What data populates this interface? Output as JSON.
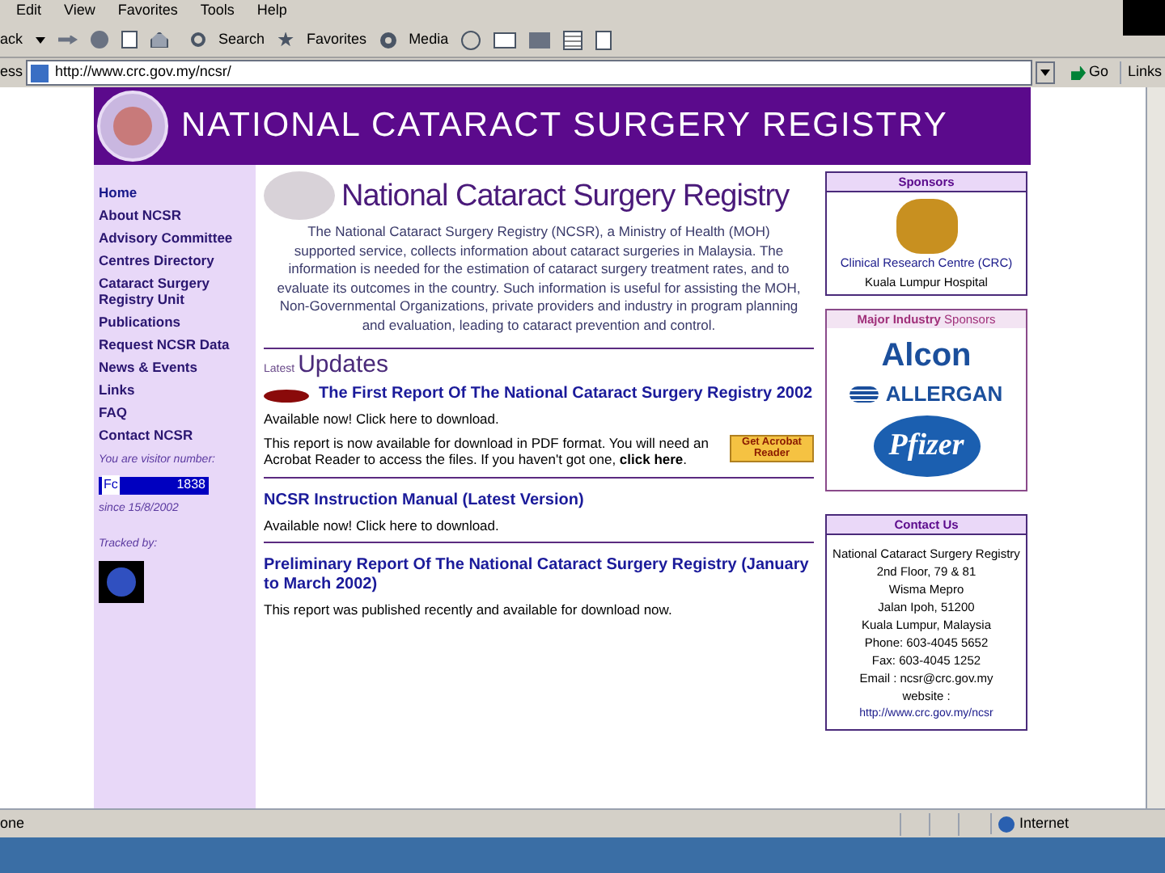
{
  "menu_bar": [
    "Edit",
    "View",
    "Favorites",
    "Tools",
    "Help"
  ],
  "toolbar": {
    "back": "ack",
    "search": "Search",
    "favorites": "Favorites",
    "media": "Media"
  },
  "address_bar": {
    "label": "ess",
    "value": "http://www.crc.gov.my/ncsr/",
    "go": "Go",
    "links": "Links"
  },
  "page": {
    "header_title": "NATIONAL CATARACT SURGERY REGISTRY",
    "nav": [
      {
        "label": "Home"
      },
      {
        "label": "**About** NCSR"
      },
      {
        "label": "Advisory Committee"
      },
      {
        "label": "Centres Directory"
      },
      {
        "label": "Cataract Surgery Registry Unit"
      },
      {
        "label": "Publications"
      },
      {
        "label": "Request NCSR Data"
      },
      {
        "label": "News & Events"
      },
      {
        "label": "Links"
      },
      {
        "label": "FAQ"
      },
      {
        "label": "**Contact** NCSR"
      }
    ],
    "visitor": {
      "label": "You are visitor number:",
      "counter_prefix": "Fc",
      "counter": "1838",
      "since": "since 15/8/2002",
      "tracked_by": "Tracked by:"
    },
    "intro": {
      "title": "National Cataract Surgery Registry",
      "text": "The National Cataract Surgery Registry (NCSR), a Ministry of Health (MOH) supported service, collects information about cataract surgeries in Malaysia. The information is needed for the estimation of cataract surgery treatment rates, and to evaluate its outcomes in the country. Such information is useful for assisting the MOH, Non-Governmental Organizations, private providers and industry in program planning and evaluation, leading to cataract prevention and control."
    },
    "updates_heading": {
      "small": "Latest",
      "large": "Updates"
    },
    "updates": [
      {
        "title": "The First Report Of The National Cataract Surgery Registry 2002",
        "icon": true,
        "lines": [
          "Available now! Click here to download.",
          "This report is now available for download in PDF format. You will need an Acrobat Reader to access the files. If you haven't got one, **click here**."
        ],
        "badge": "Get Acrobat Reader"
      },
      {
        "title": "NCSR Instruction Manual (Latest Version)",
        "icon": false,
        "lines": [
          "Available now! Click here to download."
        ]
      },
      {
        "title": "Preliminary Report Of The National Cataract Surgery Registry (January to March 2002)",
        "icon": false,
        "lines": [
          "This report was published recently and available for download now."
        ]
      }
    ],
    "sponsors": {
      "heading": "Sponsors",
      "org": "Clinical Research Centre (CRC)",
      "hospital": "Kuala Lumpur Hospital"
    },
    "industry": {
      "heading": "**Major Industry** Sponsors",
      "logos": [
        {
          "kind": "alcon",
          "text": "Alcon"
        },
        {
          "kind": "allergan",
          "text": "ALLERGAN"
        },
        {
          "kind": "pfizer",
          "text": "Pfizer"
        }
      ]
    },
    "contact": {
      "heading": "Contact Us",
      "lines": [
        "National Cataract Surgery Registry",
        "2nd Floor, 79 & 81",
        "Wisma Mepro",
        "Jalan Ipoh, 51200",
        "Kuala Lumpur, Malaysia",
        "Phone: 603-4045 5652",
        "Fax: 603-4045 1252",
        "Email : ncsr@crc.gov.my",
        "website :"
      ],
      "url": "http://www.crc.gov.my/ncsr"
    }
  },
  "status_bar": {
    "text": "one",
    "zone": "Internet"
  }
}
